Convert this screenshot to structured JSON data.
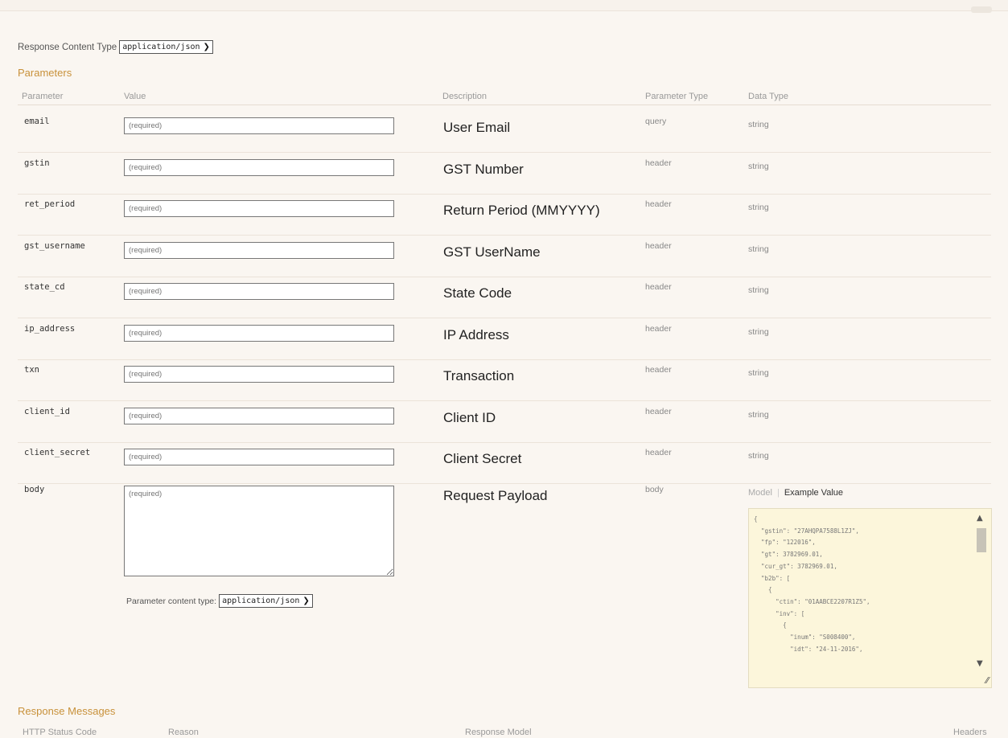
{
  "response_content_type": {
    "label": "Response Content Type",
    "value": "application/json"
  },
  "parameters_title": "Parameters",
  "columns": {
    "parameter": "Parameter",
    "value": "Value",
    "description": "Description",
    "parameter_type": "Parameter Type",
    "data_type": "Data Type"
  },
  "params": [
    {
      "name": "email",
      "placeholder": "(required)",
      "description": "User Email",
      "param_type": "query",
      "data_type": "string"
    },
    {
      "name": "gstin",
      "placeholder": "(required)",
      "description": "GST Number",
      "param_type": "header",
      "data_type": "string"
    },
    {
      "name": "ret_period",
      "placeholder": "(required)",
      "description": "Return Period (MMYYYY)",
      "param_type": "header",
      "data_type": "string"
    },
    {
      "name": "gst_username",
      "placeholder": "(required)",
      "description": "GST UserName",
      "param_type": "header",
      "data_type": "string"
    },
    {
      "name": "state_cd",
      "placeholder": "(required)",
      "description": "State Code",
      "param_type": "header",
      "data_type": "string"
    },
    {
      "name": "ip_address",
      "placeholder": "(required)",
      "description": "IP Address",
      "param_type": "header",
      "data_type": "string"
    },
    {
      "name": "txn",
      "placeholder": "(required)",
      "description": "Transaction",
      "param_type": "header",
      "data_type": "string"
    },
    {
      "name": "client_id",
      "placeholder": "(required)",
      "description": "Client ID",
      "param_type": "header",
      "data_type": "string"
    },
    {
      "name": "client_secret",
      "placeholder": "(required)",
      "description": "Client Secret",
      "param_type": "header",
      "data_type": "string"
    }
  ],
  "body_param": {
    "name": "body",
    "placeholder": "(required)",
    "description": "Request Payload",
    "param_type": "body",
    "content_type_label": "Parameter content type:",
    "content_type_value": "application/json",
    "model_tab": "Model",
    "example_tab": "Example Value",
    "example_value": "{\n  \"gstin\": \"27AHQPA7588L1ZJ\",\n  \"fp\": \"122016\",\n  \"gt\": 3782969.01,\n  \"cur_gt\": 3782969.01,\n  \"b2b\": [\n    {\n      \"ctin\": \"01AABCE2207R1Z5\",\n      \"inv\": [\n        {\n          \"inum\": \"S008400\",\n          \"idt\": \"24-11-2016\","
  },
  "response_messages": {
    "title": "Response Messages",
    "columns": [
      "HTTP Status Code",
      "Reason",
      "Response Model",
      "Headers"
    ]
  }
}
